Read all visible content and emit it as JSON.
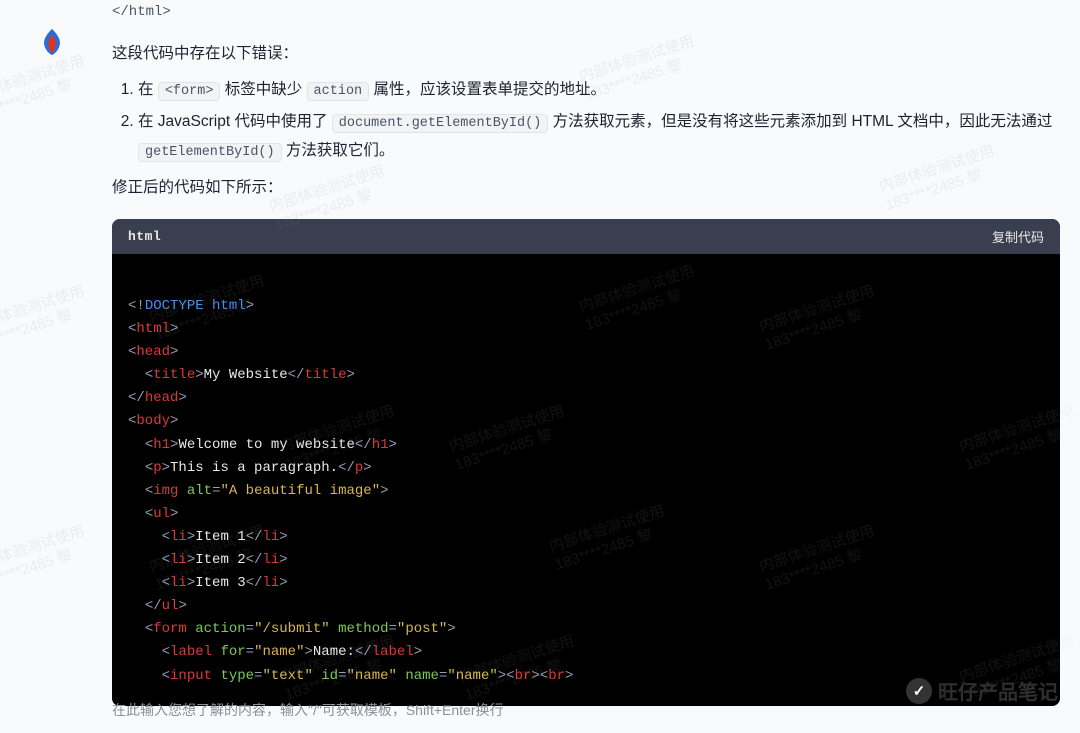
{
  "prior_code": "</html>",
  "response": {
    "intro": "这段代码中存在以下错误：",
    "item1a": "在 ",
    "item1b": " 标签中缺少 ",
    "item1c": " 属性，应该设置表单提交的地址。",
    "item1_code1": "<form>",
    "item1_code2": "action",
    "item2a": "在 JavaScript 代码中使用了 ",
    "item2b": " 方法获取元素，但是没有将这些元素添加到 HTML 文档中，因此无法通过 ",
    "item2c": " 方法获取它们。",
    "item2_code1": "document.getElementById()",
    "item2_code2": "getElementById()",
    "fixed_label": "修正后的代码如下所示："
  },
  "codeblock": {
    "lang": "html",
    "copy_label": "复制代码",
    "doctype": "DOCTYPE html",
    "title_text": "My Website",
    "h1_text": "Welcome to my website",
    "p_text": "This is a paragraph.",
    "img_alt": "\"A beautiful image\"",
    "li1": "Item 1",
    "li2": "Item 2",
    "li3": "Item 3",
    "form_action": "\"/submit\"",
    "form_method": "\"post\"",
    "label_for": "\"name\"",
    "label_text": "Name:",
    "input_type": "\"text\"",
    "input_id": "\"name\"",
    "input_name": "\"name\""
  },
  "input_placeholder": "在此输入您想了解的内容，输入\"/\"可获取模板，Shift+Enter换行",
  "watermark": {
    "line1": "内部体验测试使用",
    "line2": "183****2485 黎"
  },
  "footer_badge": "旺仔产品笔记"
}
